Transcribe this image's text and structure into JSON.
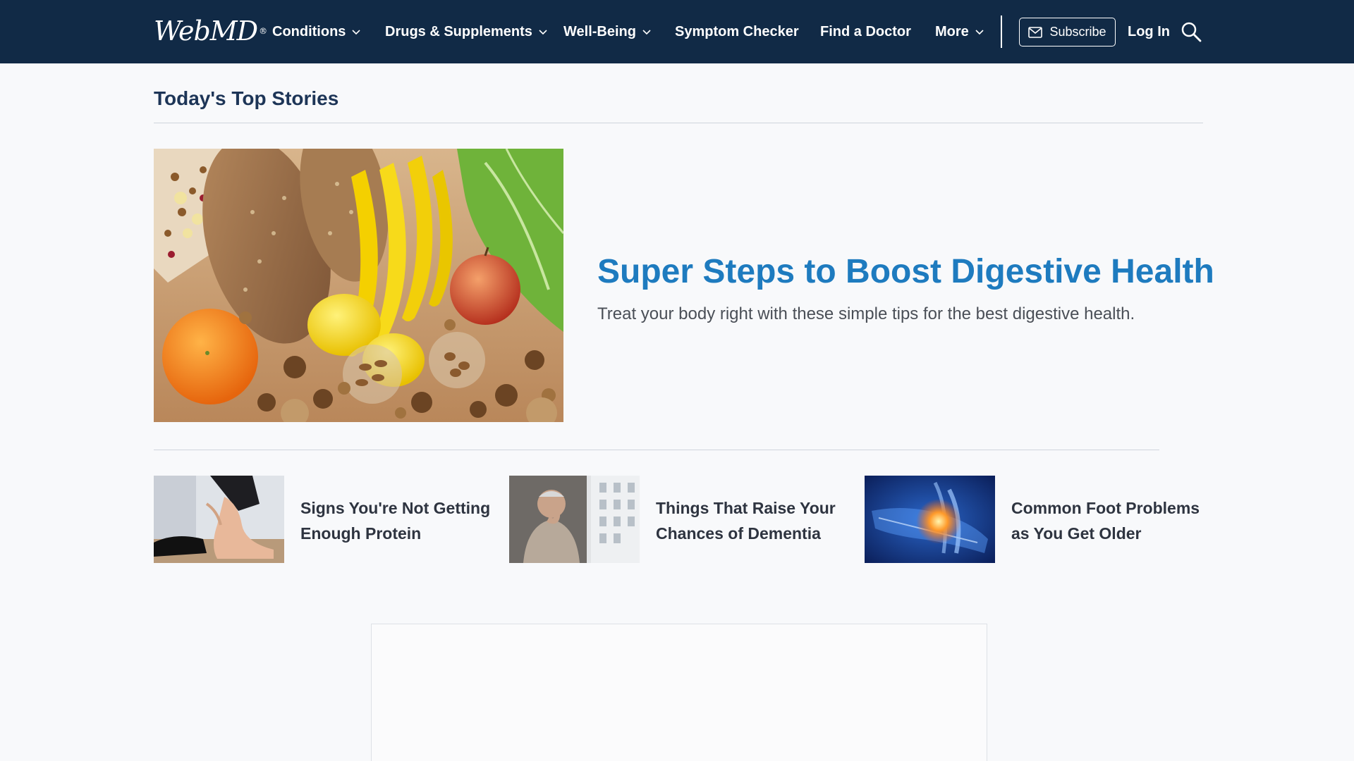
{
  "nav": {
    "logo": "WebMD",
    "logo_mark": "®",
    "items": [
      {
        "label": "Conditions",
        "has_dropdown": true
      },
      {
        "label": "Drugs & Supplements",
        "has_dropdown": true
      },
      {
        "label": "Well-Being",
        "has_dropdown": true
      },
      {
        "label": "Symptom Checker",
        "has_dropdown": false
      },
      {
        "label": "Find a Doctor",
        "has_dropdown": false
      },
      {
        "label": "More",
        "has_dropdown": true
      }
    ],
    "subscribe_label": "Subscribe",
    "login_label": "Log In",
    "search_icon": "search-icon"
  },
  "section": {
    "title": "Today's Top Stories"
  },
  "hero": {
    "title": "Super Steps to Boost Digestive Health",
    "description": "Treat your body right with these simple tips for the best digestive health."
  },
  "stories": [
    {
      "title": "Signs You're Not Getting Enough Protein"
    },
    {
      "title": "Things That Raise Your Chances of Dementia"
    },
    {
      "title": "Common Foot Problems as You Get Older"
    }
  ],
  "colors": {
    "nav_bg": "#112a46",
    "hero_title": "#1e7bbf",
    "section_title": "#1d3557",
    "page_bg": "#f8f9fb"
  }
}
